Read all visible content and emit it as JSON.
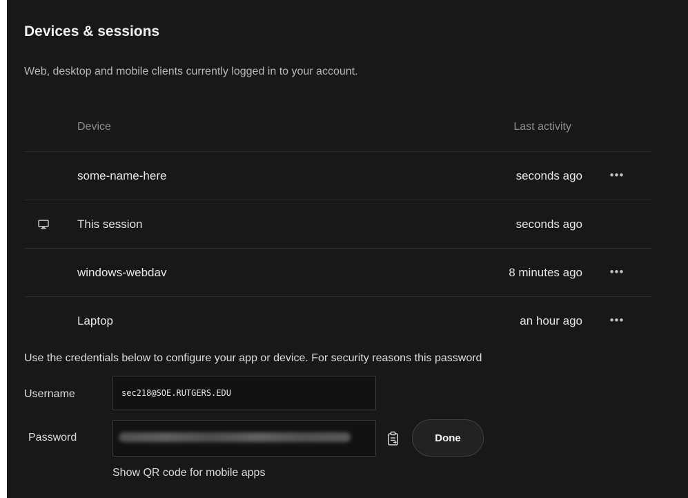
{
  "header": {
    "title": "Devices & sessions",
    "subtitle": "Web, desktop and mobile clients currently logged in to your account."
  },
  "table": {
    "columns": [
      "Device",
      "Last activity"
    ],
    "rows": [
      {
        "device": "some-name-here",
        "last_activity": "seconds ago",
        "menu": "•••",
        "icon": ""
      },
      {
        "device": "This session",
        "last_activity": "seconds ago",
        "menu": "",
        "icon": "monitor-icon"
      },
      {
        "device": "windows-webdav",
        "last_activity": "8 minutes ago",
        "menu": "•••",
        "icon": ""
      },
      {
        "device": "Laptop",
        "last_activity": "an hour ago",
        "menu": "•••",
        "icon": ""
      }
    ]
  },
  "credentials": {
    "instructions": "Use the credentials below to configure your app or device. For security reasons this password",
    "username_label": "Username",
    "username_value": "sec218@SOE.RUTGERS.EDU",
    "password_label": "Password",
    "copy_icon": "clipboard-icon",
    "done_label": "Done",
    "qr_link": "Show QR code for mobile apps"
  },
  "colors": {
    "background": "#181818",
    "text": "#e6e6e6",
    "muted": "#8f8f8f",
    "divider": "#2d2d2d"
  }
}
